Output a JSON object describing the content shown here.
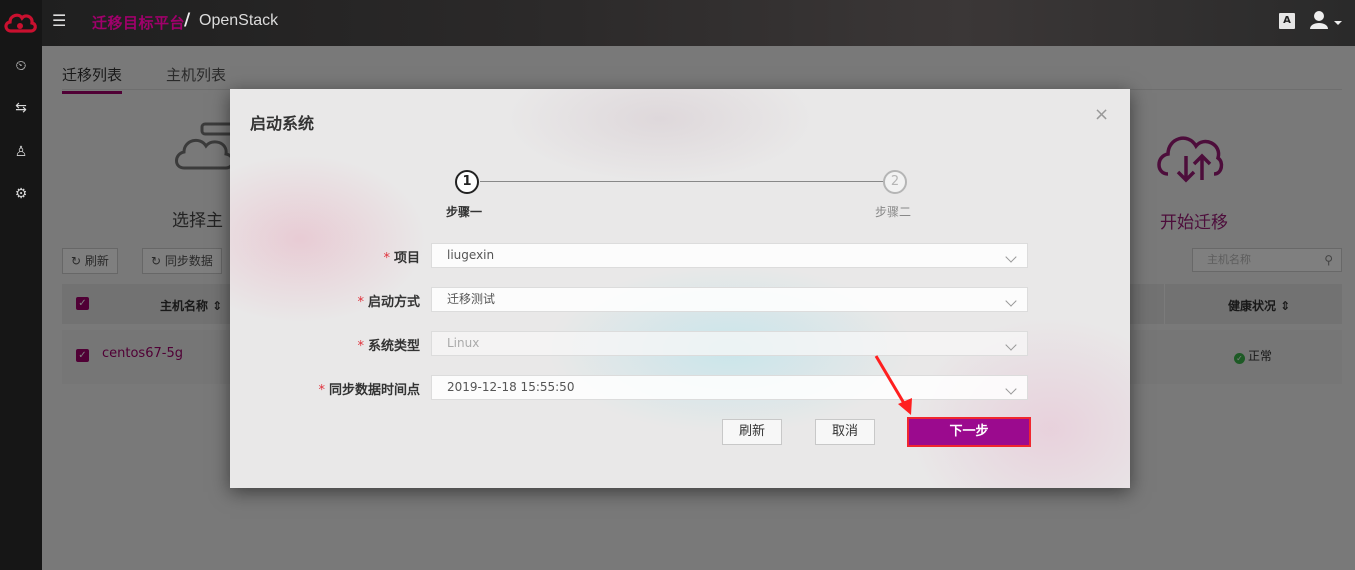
{
  "topbar": {
    "platform": "迁移目标平台",
    "separator": "/",
    "target": "OpenStack",
    "lang_icon": "A"
  },
  "sidebar": {
    "items": [
      {
        "icon": "dashboard-icon",
        "glyph": "⏲"
      },
      {
        "icon": "swap-icon",
        "glyph": "⇆"
      },
      {
        "icon": "user-icon",
        "glyph": "♙"
      },
      {
        "icon": "gear-icon",
        "glyph": "⚙"
      }
    ]
  },
  "page": {
    "tabs": [
      {
        "label": "迁移列表",
        "active": true
      },
      {
        "label": "主机列表",
        "active": false
      }
    ],
    "flow_left_label": "选择主",
    "flow_right_label": "开始迁移",
    "toolbar": {
      "refresh_label": "刷新",
      "sync_label": "同步数据",
      "search_placeholder": "主机名称"
    },
    "table": {
      "headers": [
        "主机名称",
        "健康状况"
      ],
      "rows": [
        {
          "host": "centos67-5g",
          "health": "正常"
        }
      ]
    }
  },
  "modal": {
    "title": "启动系统",
    "close": "×",
    "steps": [
      {
        "number": "1",
        "label": "步骤一",
        "active": true
      },
      {
        "number": "2",
        "label": "步骤二",
        "active": false
      }
    ],
    "fields": [
      {
        "required": "*",
        "label": "项目",
        "value": "liugexin",
        "disabled": false
      },
      {
        "required": "*",
        "label": "启动方式",
        "value": "迁移测试",
        "disabled": false
      },
      {
        "required": "*",
        "label": "系统类型",
        "value": "Linux",
        "disabled": true
      },
      {
        "required": "*",
        "label": "同步数据时间点",
        "value": "2019-12-18 15:55:50",
        "disabled": false
      }
    ],
    "buttons": {
      "refresh": "刷新",
      "cancel": "取消",
      "next": "下一步"
    }
  },
  "colors": {
    "brand": "#a0006b",
    "primary_button": "#9b0a8e",
    "highlight_border": "#f0262f",
    "required": "#e0303a",
    "healthy": "#3ab54a"
  }
}
